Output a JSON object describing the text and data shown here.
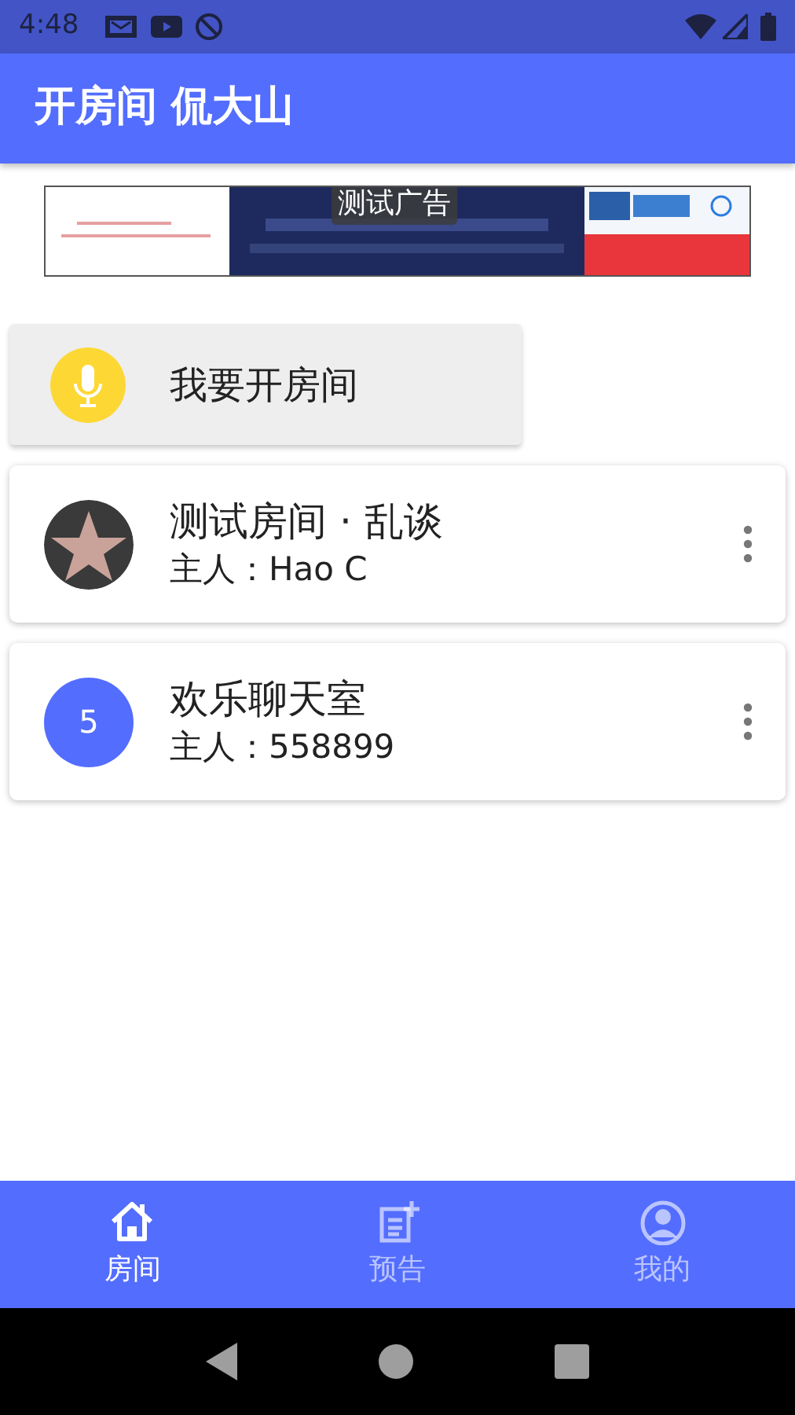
{
  "status_bar": {
    "time": "4:48"
  },
  "app_bar": {
    "title": "开房间 侃大山"
  },
  "ad": {
    "kind": "picture",
    "label": "测试广告"
  },
  "create_room": {
    "label": "我要开房间"
  },
  "rooms": [
    {
      "title": "测试房间 · 乱谈",
      "owner": "主人：Hao C"
    },
    {
      "kind": "letter",
      "avatar_text": "5",
      "title": "欢乐聊天室",
      "owner": "主人：558899"
    }
  ],
  "bottom_nav": [
    {
      "label": "房间",
      "selected": true
    },
    {
      "label": "预告",
      "selected": false
    },
    {
      "label": "我的",
      "selected": false
    }
  ]
}
